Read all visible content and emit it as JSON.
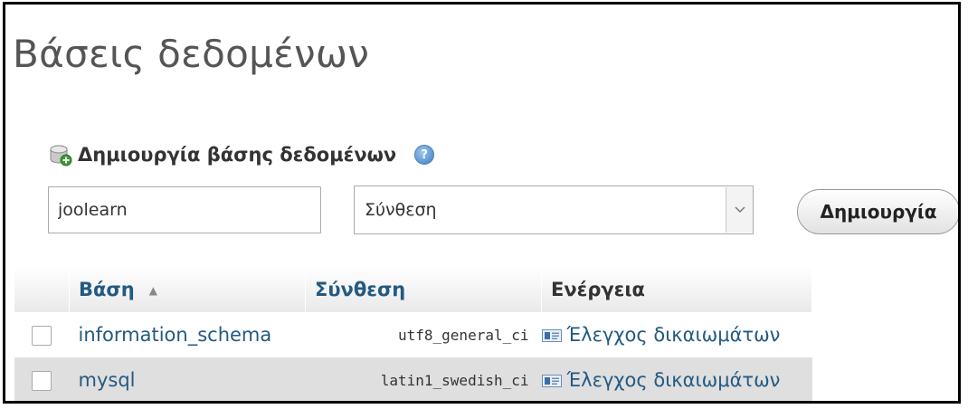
{
  "page": {
    "title": "Βάσεις δεδομένων"
  },
  "create_db": {
    "heading": "Δημιουργία βάσης δεδομένων",
    "name_value": "joolearn",
    "collation_selected": "Σύνθεση",
    "create_label": "Δημιουργία",
    "icons": {
      "heading_icon": "database-add-icon",
      "help_icon": "help-icon",
      "select_arrow": "chevron-down-icon"
    }
  },
  "table": {
    "headers": {
      "name": "Βάση",
      "collation": "Σύνθεση",
      "action": "Ενέργεια"
    },
    "rows": [
      {
        "name": "information_schema",
        "collation": "utf8_general_ci",
        "action": "Έλεγχος δικαιωμάτων"
      },
      {
        "name": "mysql",
        "collation": "latin1_swedish_ci",
        "action": "Έλεγχος δικαιωμάτων"
      }
    ]
  },
  "colors": {
    "link": "#235a81",
    "row_alt": "#dfdfdf",
    "title": "#555555"
  }
}
